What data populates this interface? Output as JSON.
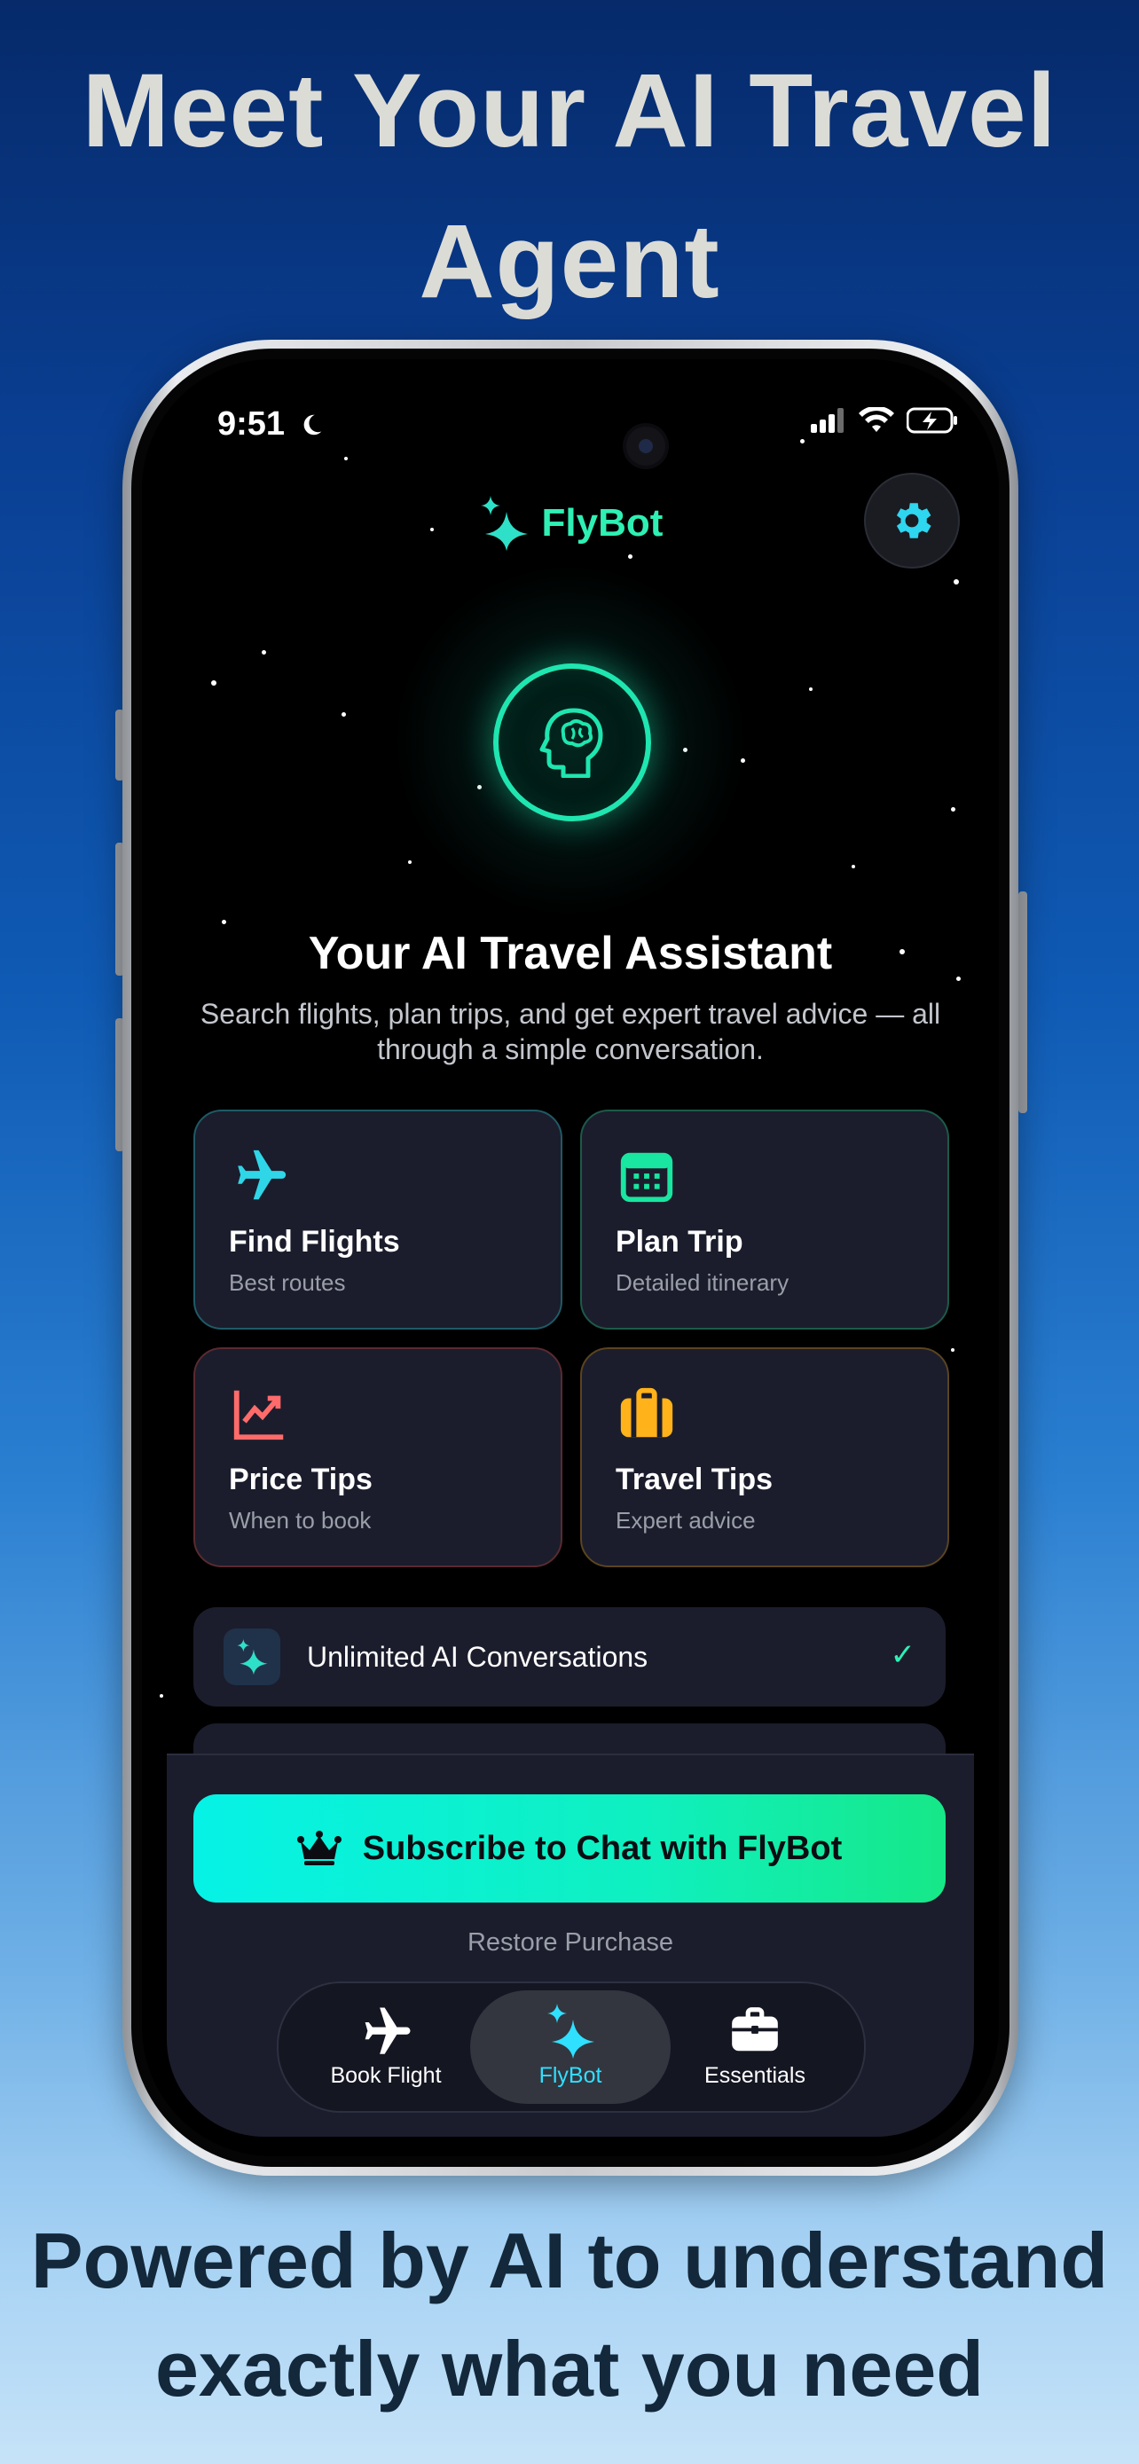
{
  "promo": {
    "headline_top": "Meet Your AI Travel Agent",
    "headline_bottom": "Powered by AI to understand exactly what you need"
  },
  "status_bar": {
    "time": "9:51"
  },
  "header": {
    "title": "FlyBot",
    "settings_icon": "gear-icon"
  },
  "hero": {
    "icon": "brain-head-icon",
    "title": "Your AI Travel Assistant",
    "subtitle": "Search flights, plan trips, and get expert travel advice — all through a simple conversation."
  },
  "cards": [
    {
      "title": "Find Flights",
      "subtitle": "Best routes",
      "icon": "airplane-icon",
      "color": "#2fd6e8",
      "border": "#1f5a66"
    },
    {
      "title": "Plan Trip",
      "subtitle": "Detailed itinerary",
      "icon": "calendar-icon",
      "color": "#19e6a0",
      "border": "#1d5a48"
    },
    {
      "title": "Price Tips",
      "subtitle": "When to book",
      "icon": "chart-icon",
      "color": "#ff6b6b",
      "border": "#5a2a30"
    },
    {
      "title": "Travel Tips",
      "subtitle": "Expert advice",
      "icon": "suitcase-icon",
      "color": "#ffb21a",
      "border": "#5a4420"
    }
  ],
  "features": [
    {
      "label": "Unlimited AI Conversations",
      "icon": "sparkles-icon",
      "check": "✓"
    }
  ],
  "subscribe": {
    "label": "Subscribe to Chat with FlyBot",
    "icon": "crown-icon"
  },
  "restore": "Restore Purchase",
  "tabs": [
    {
      "label": "Book Flight",
      "icon": "airplane-icon",
      "active": false
    },
    {
      "label": "FlyBot",
      "icon": "sparkles-icon",
      "active": true
    },
    {
      "label": "Essentials",
      "icon": "briefcase-icon",
      "active": false
    }
  ],
  "colors": {
    "accent": "#2ef0b4",
    "tab_active": "#2fe0ff",
    "card_bg": "#1b1d2c"
  }
}
